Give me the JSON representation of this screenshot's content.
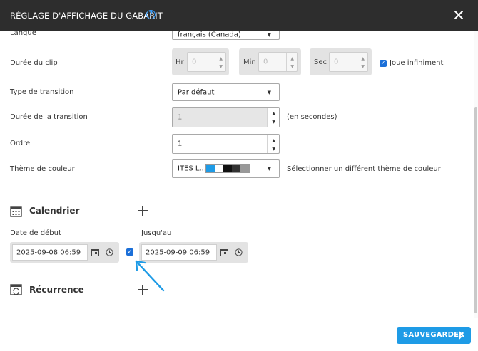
{
  "header": {
    "title": "RÉGLAGE D'AFFICHAGE DU GABARIT",
    "help": "?"
  },
  "form": {
    "language": {
      "label": "Langue",
      "value": "français (Canada)"
    },
    "clip_duration": {
      "label": "Durée du clip",
      "hr_label": "Hr",
      "hr_value": "0",
      "min_label": "Min",
      "min_value": "0",
      "sec_label": "Sec",
      "sec_value": "0",
      "infinite_label": "Joue infiniment",
      "infinite_checked": true
    },
    "transition_type": {
      "label": "Type de transition",
      "value": "Par défaut"
    },
    "transition_duration": {
      "label": "Durée de la transition",
      "value": "1",
      "unit": "(en secondes)"
    },
    "order": {
      "label": "Ordre",
      "value": "1"
    },
    "color_theme": {
      "label": "Thème de couleur",
      "value": "ITES L...",
      "swatches": [
        "#1e9be6",
        "#ffffff",
        "#111111",
        "#333333",
        "#999999"
      ],
      "link": "Sélectionner un différent thème de couleur"
    }
  },
  "calendar": {
    "title": "Calendrier",
    "start_label": "Date de début",
    "start_value": "2025-09-08 06:59",
    "end_label": "Jusqu'au",
    "end_value": "2025-09-09 06:59",
    "end_enabled": true
  },
  "recurrence": {
    "title": "Récurrence"
  },
  "footer": {
    "save_label": "SAUVEGARDER"
  },
  "colors": {
    "header_bg": "#2d2d2d",
    "accent": "#1e9be6",
    "annotation_arrow": "#1e9be6"
  }
}
